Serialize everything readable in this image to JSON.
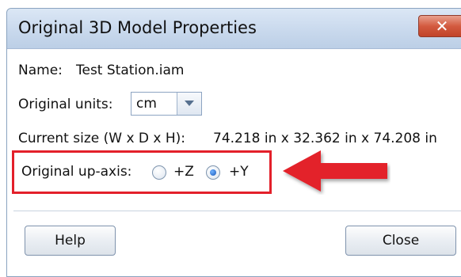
{
  "window": {
    "title": "Original 3D Model Properties",
    "close_glyph": "✕"
  },
  "name": {
    "label": "Name:",
    "value": "Test Station.iam"
  },
  "units": {
    "label": "Original units:",
    "selected": "cm"
  },
  "current_size": {
    "label": "Current size (W x D x H):",
    "value": "74.218 in x 32.362 in x 74.208 in"
  },
  "up_axis": {
    "label": "Original up-axis:",
    "options": [
      {
        "label": "+Z",
        "selected": false
      },
      {
        "label": "+Y",
        "selected": true
      }
    ]
  },
  "annotation": {
    "arrow_color": "#e3202a",
    "box_color": "#e3202a"
  },
  "buttons": {
    "help": "Help",
    "close": "Close"
  }
}
